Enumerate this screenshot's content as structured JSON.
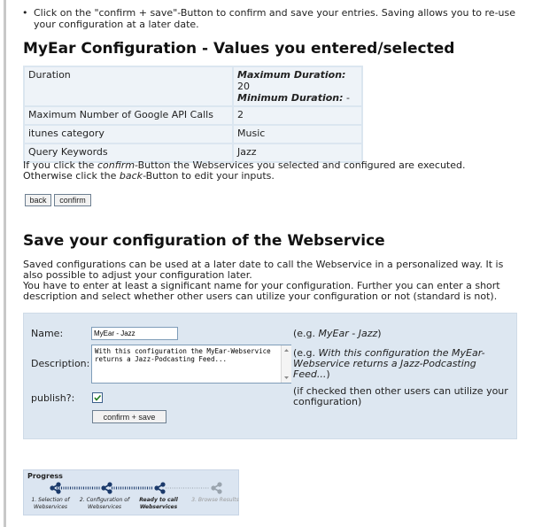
{
  "bullet": {
    "marker": "•",
    "text": "Click on the \"confirm + save\"-Button to confirm and save your entries. Saving allows you to re-use your configuration at a later date."
  },
  "values_section": {
    "heading": "MyEar Configuration - Values you entered/selected",
    "rows": [
      {
        "label": "Duration",
        "max_label": "Maximum Duration:",
        "max_value": "20",
        "min_label": "Minimum Duration:",
        "min_value": "-"
      },
      {
        "label": "Maximum Number of Google API Calls",
        "value": "2"
      },
      {
        "label": "itunes category",
        "value": "Music"
      },
      {
        "label": "Query Keywords",
        "value": "Jazz"
      }
    ],
    "info_line1_pre": "If you click the ",
    "info_line1_em": "confirm",
    "info_line1_post": "-Button the Webservices you selected and configured are executed.",
    "info_line2_pre": "Otherwise click the ",
    "info_line2_em": "back",
    "info_line2_post": "-Button to edit your inputs.",
    "back_label": "back",
    "confirm_label": "confirm"
  },
  "save_section": {
    "heading": "Save your configuration of the Webservice",
    "para1": "Saved configurations can be used at a later date to call the Webservice in a personalized way. It is also possible to adjust your configuration later.",
    "para2": "You have to enter at least a significant name for your configuration. Further you can enter a short description and select whether other users can utilize your configuration or not (standard is not)."
  },
  "form": {
    "name_label": "Name:",
    "name_value": "MyEar - Jazz",
    "name_hint_pre": "(e.g. ",
    "name_hint_em": "MyEar - Jazz",
    "name_hint_post": ")",
    "description_label": "Description:",
    "description_value": "With this configuration the MyEar-Webservice returns a Jazz-Podcasting Feed...",
    "description_hint_pre": "(e.g. ",
    "description_hint_em": "With this configuration the MyEar-Webservice returns a Jazz-Podcasting Feed...",
    "description_hint_post": ")",
    "publish_label": "publish?:",
    "publish_checked": true,
    "publish_hint": "(if checked then other users can utilize your configuration)",
    "submit_label": "confirm + save"
  },
  "progress": {
    "title": "Progress",
    "steps": [
      {
        "number": "1.",
        "label": "Selection of Webservices",
        "state": "done"
      },
      {
        "number": "2.",
        "label": "Configuration of Webservices",
        "state": "done"
      },
      {
        "number": "",
        "label": "Ready to call Webservices",
        "state": "current"
      },
      {
        "number": "3.",
        "label": "Browse Results",
        "state": "pending"
      }
    ]
  },
  "colors": {
    "table_bg": "#dbe6f0",
    "form_bg": "#dde7f1",
    "icon_active": "#1b3a6b",
    "icon_inactive": "#9aa4ae"
  }
}
